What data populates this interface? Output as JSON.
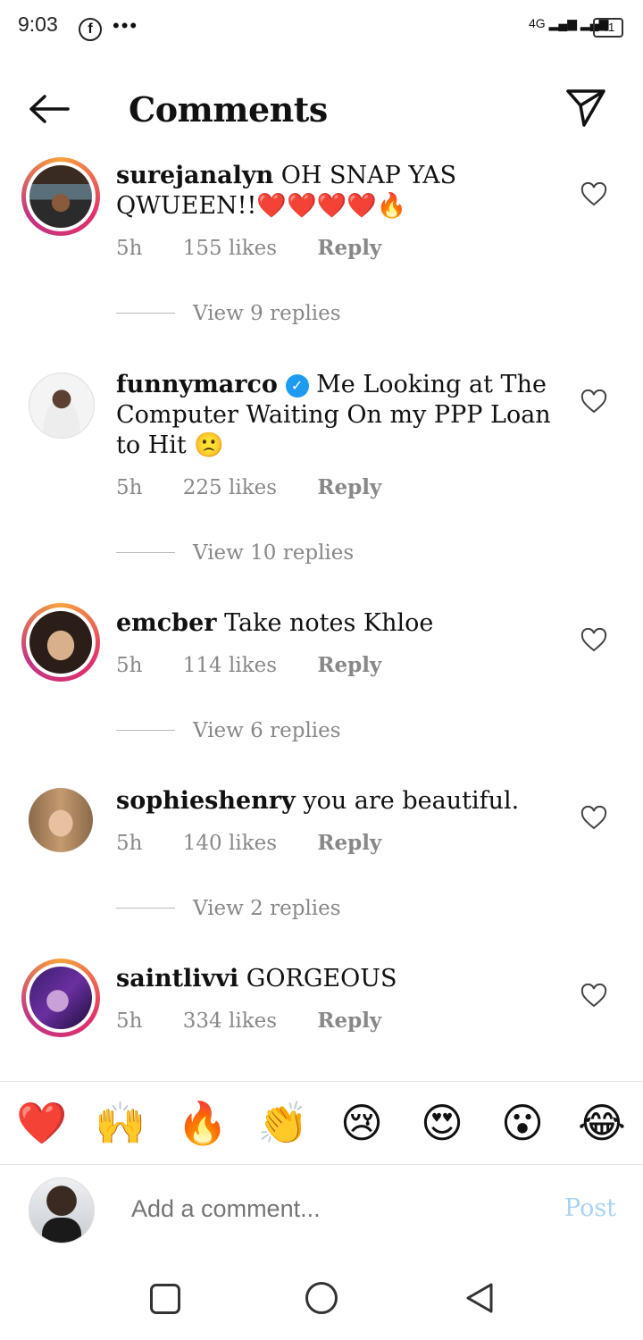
{
  "status_bar": {
    "time": "9:03",
    "network": "4G",
    "battery": "41"
  },
  "header": {
    "title": "Comments",
    "back_icon": "arrow-left-icon",
    "send_icon": "paper-plane-icon"
  },
  "comments": [
    {
      "username": "surejanalyn",
      "text": "OH SNAP YAS QWUEEN!!❤️❤️❤️❤️🔥",
      "verified": false,
      "time": "5h",
      "likes": "155 likes",
      "reply": "Reply",
      "view_replies": "View 9 replies"
    },
    {
      "username": "funnymarco",
      "text": "Me Looking at The Computer Waiting On my PPP Loan to Hit 🙁",
      "verified": true,
      "time": "5h",
      "likes": "225 likes",
      "reply": "Reply",
      "view_replies": "View 10 replies"
    },
    {
      "username": "emcber",
      "text": "Take notes Khloe",
      "verified": false,
      "time": "5h",
      "likes": "114 likes",
      "reply": "Reply",
      "view_replies": "View 6 replies"
    },
    {
      "username": "sophieshenry",
      "text": "you are beautiful.",
      "verified": false,
      "time": "5h",
      "likes": "140 likes",
      "reply": "Reply",
      "view_replies": "View 2 replies"
    },
    {
      "username": "saintlivvi",
      "text": "GORGEOUS",
      "verified": false,
      "time": "5h",
      "likes": "334 likes",
      "reply": "Reply"
    }
  ],
  "quick_reactions": [
    "❤️",
    "🙌",
    "🔥",
    "👏",
    "😢",
    "😍",
    "😮",
    "😂"
  ],
  "composer": {
    "placeholder": "Add a comment...",
    "post_label": "Post"
  },
  "colors": {
    "story_ring": "#e1306c",
    "verified": "#1d9bf0",
    "post_disabled": "#a9d3f5",
    "meta": "#888888"
  }
}
